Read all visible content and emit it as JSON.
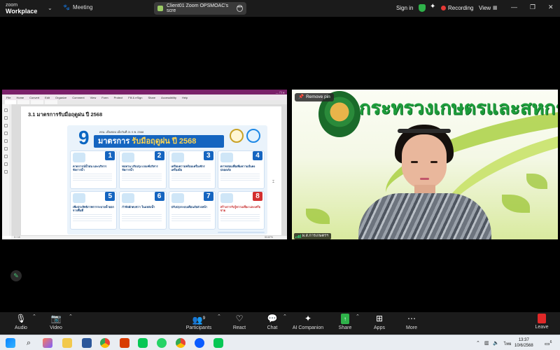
{
  "topbar": {
    "brand_line1": "zoom",
    "brand_line2": "Workplace",
    "meeting_label": "Meeting",
    "share_title": "Client01 Zoom OPSMOAC's scre",
    "signin_label": "Sign in",
    "recording_label": "Recording",
    "view_label": "View"
  },
  "shared_screen": {
    "menu": [
      "File",
      "Home",
      "Convert",
      "Edit",
      "Organize",
      "Comment",
      "View",
      "Form",
      "Protect",
      "Fill & eSign",
      "Share",
      "Accessibility",
      "Help"
    ],
    "section_title": "3.1 มาตรการรับมือฤดูฝน ปี 2568",
    "infographic": {
      "big_number": "9",
      "headline_a": "มาตรการ",
      "headline_b": "รับมือฤดูฝน ปี 2568",
      "subline": "ครม. เห็นชอบ เมื่อวันที่ 21 ก.พ. 2568",
      "cards": [
        {
          "num": "1",
          "text": "คาดการณ์น้ำฝน และบริหารจัดการน้ำ",
          "accent": "#1565c0"
        },
        {
          "num": "2",
          "text": "ทบทวน ปรับปรุง เกณฑ์บริหารจัดการน้ำ",
          "accent": "#1565c0"
        },
        {
          "num": "3",
          "text": "เตรียมความพร้อมเครื่องจักร เครื่องมือ",
          "accent": "#1565c0"
        },
        {
          "num": "4",
          "text": "ตรวจสอบเพื่อเพิ่มความมั่นคงปลอดภัย",
          "accent": "#1565c0"
        },
        {
          "num": "5",
          "text": "เพิ่มประสิทธิภาพการระบายน้ำออกจากพื้นที่",
          "accent": "#1565c0"
        },
        {
          "num": "6",
          "text": "กำจัดผักตบชวา ในแหล่งน้ำ",
          "accent": "#1565c0"
        },
        {
          "num": "7",
          "text": "ปรับปรุงระบบเตือนภัยล่วงหน้า",
          "accent": "#1565c0"
        },
        {
          "num": "8",
          "text": "สร้างการรับรู้ความเสี่ยง และเครือข่าย",
          "accent": "#d32f2f"
        },
        {
          "num": "9",
          "text": "ติดตามประเมินผล ถอดบทเรียน",
          "accent": "#1565c0"
        }
      ]
    },
    "page_indicator": "3 / 10",
    "zoom_level": "53.87%"
  },
  "video": {
    "ministry_text": "กระทรวงเกษตรและสหกรณ์",
    "remove_pin_label": "Remove pin",
    "participant_name": "ผ.ส.การเกษตรฯ"
  },
  "toolbar": {
    "items": [
      {
        "label": "Audio"
      },
      {
        "label": "Video"
      },
      {
        "label": "Participants",
        "count": "9"
      },
      {
        "label": "React"
      },
      {
        "label": "Chat"
      },
      {
        "label": "AI Companion"
      },
      {
        "label": "Share"
      },
      {
        "label": "Apps"
      },
      {
        "label": "More"
      },
      {
        "label": "Leave"
      }
    ]
  },
  "taskbar": {
    "language": "ไทย",
    "time": "13:37",
    "date": "10/6/2568",
    "notification_count": "6"
  },
  "colors": {
    "accent_green": "#2fb24a",
    "record_red": "#e53935",
    "leave_red": "#e02828",
    "ministry_green": "#1e9e3c"
  }
}
